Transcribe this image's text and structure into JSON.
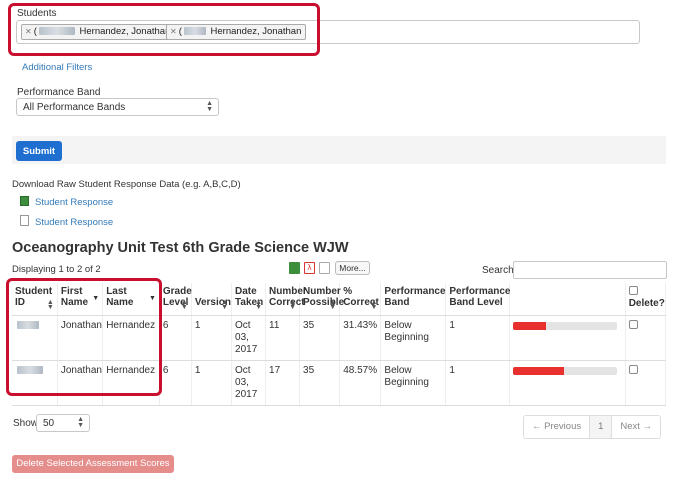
{
  "students": {
    "label": "Students",
    "tokens": [
      {
        "prefix": "(",
        "name": "Hernandez, Jonathan"
      },
      {
        "prefix": "(",
        "name": "Hernandez, Jonathan"
      }
    ]
  },
  "filters": {
    "additional_filters_link": "Additional Filters",
    "performance_band_label": "Performance Band",
    "performance_band_value": "All Performance Bands"
  },
  "actions": {
    "submit_label": "Submit"
  },
  "downloads": {
    "label": "Download Raw Student Response Data (e.g. A,B,C,D)",
    "links": [
      "Student Response",
      "Student Response"
    ]
  },
  "report": {
    "title": "Oceanography Unit Test 6th Grade Science WJW",
    "displaying": "Displaying 1 to 2 of 2",
    "more_button": "More...",
    "search_label": "Search"
  },
  "table": {
    "headers": {
      "student_id": "Student ID",
      "first_name": "First Name",
      "last_name": "Last Name",
      "grade_level": "Grade Level",
      "version": "Version",
      "date_taken": "Date Taken",
      "number_correct": "Number Correct",
      "number_possible": "Number Possible",
      "percent_correct": "% Correct",
      "performance_band": "Performance Band",
      "performance_band_level": "Performance Band Level",
      "delete": "Delete?"
    },
    "rows": [
      {
        "first": "Jonathan",
        "last": "Hernandez",
        "grade": "6",
        "version": "1",
        "date": "Oct 03, 2017",
        "correct": "11",
        "possible": "35",
        "pct": "31.43%",
        "band": "Below Beginning",
        "level": "1",
        "fill": 0.3143
      },
      {
        "first": "Jonathan",
        "last": "Hernandez",
        "grade": "6",
        "version": "1",
        "date": "Oct 03, 2017",
        "correct": "17",
        "possible": "35",
        "pct": "48.57%",
        "band": "Below Beginning",
        "level": "1",
        "fill": 0.4857
      }
    ]
  },
  "footer": {
    "show_label": "Show",
    "show_value": "50",
    "prev": "← Previous",
    "page": "1",
    "next": "Next →",
    "delete_button": "Delete Selected Assessment Scores"
  },
  "colors": {
    "highlight": "#c8102e",
    "submit": "#1f6fd0",
    "bar": "#e8312f",
    "delete_button": "#e48d8b"
  }
}
